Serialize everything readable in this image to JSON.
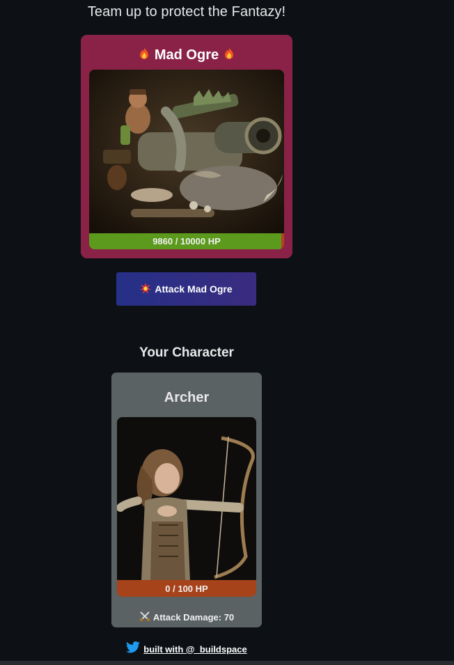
{
  "header": {
    "subtitle": "Team up to protect the Fantazy!"
  },
  "boss": {
    "name": "Mad Ogre",
    "title_icon": "fire-icon",
    "image_alt": "Mad Ogre",
    "hp_text": "9860 / 10000 HP",
    "hp_current": 9860,
    "hp_max": 10000,
    "colors": {
      "card": "#8a2248",
      "hp_fill": "#5b9a1c",
      "hp_track": "#b3431e"
    }
  },
  "attack_button": {
    "label": "Attack Mad Ogre",
    "icon": "collision-icon"
  },
  "player": {
    "section_title": "Your Character",
    "name": "Archer",
    "image_alt": "Archer",
    "hp_text": "0 / 100 HP",
    "hp_current": 0,
    "hp_max": 100,
    "damage_label": "Attack Damage: 70",
    "damage_icon": "crossed-swords-icon",
    "colors": {
      "card": "#5a6264",
      "hp_track": "#a6431a"
    }
  },
  "footer": {
    "link_text": "built with @_buildspace",
    "icon": "twitter-icon"
  }
}
